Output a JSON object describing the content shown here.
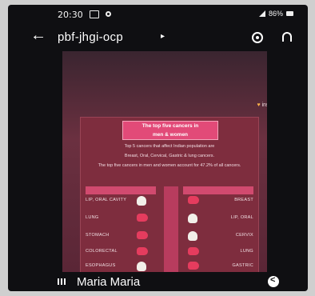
{
  "status_bar": {
    "time": "20:30",
    "battery": "86%"
  },
  "top_bar": {
    "title": "pbf-jhgi-ocp",
    "title_caret": "▸",
    "back_icon": "←"
  },
  "media": {
    "insight_label": "insig",
    "insight_icon": "♥",
    "infographic": {
      "title_line_1": "The top five cancers in",
      "title_line_2": "men & women",
      "body_line_1": "Top 5 cancers that affect Indian population are",
      "body_line_2": "Breast, Oral, Cervical, Gastric & lung cancers.",
      "body_line_3": "The top five cancers in men and women account for 47.2% of all cancers.",
      "left_column": [
        "LIP, ORAL CAVITY",
        "LUNG",
        "STOMACH",
        "COLORECTAL",
        "ESOPHAGUS"
      ],
      "right_column": [
        "BREAST",
        "LIP, ORAL",
        "CERVIX",
        "LUNG",
        "GASTRIC"
      ]
    }
  },
  "bottom_bar": {
    "track_title": "Maria Maria"
  }
}
